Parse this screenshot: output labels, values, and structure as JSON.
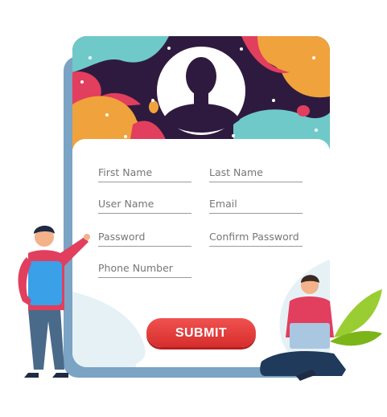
{
  "form": {
    "fields": [
      {
        "placeholder": "First Name"
      },
      {
        "placeholder": "Last Name"
      },
      {
        "placeholder": "User Name"
      },
      {
        "placeholder": "Email"
      },
      {
        "placeholder": "Password"
      },
      {
        "placeholder": "Confirm Password"
      },
      {
        "placeholder": "Phone Number"
      }
    ],
    "submit_label": "SUBMIT"
  },
  "colors": {
    "header_bg": "#2f1a3f",
    "accent": "#e63b3b",
    "teal": "#6fc9c9",
    "orange": "#f0a23c",
    "pink": "#e23e5e"
  },
  "icons": {
    "avatar": "user-silhouette-icon"
  }
}
